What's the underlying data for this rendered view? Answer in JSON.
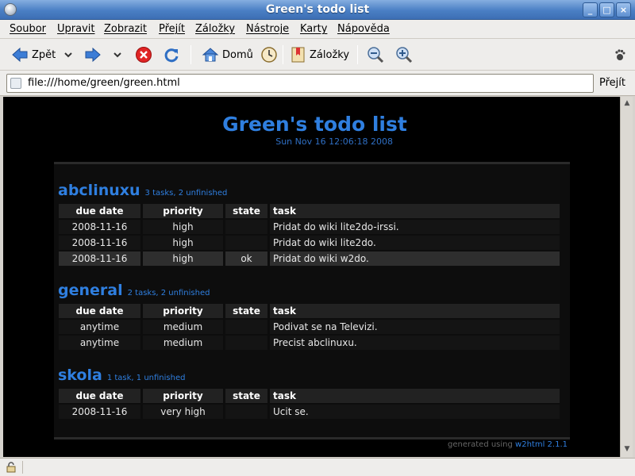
{
  "window": {
    "title": "Green's todo list"
  },
  "menu": [
    "Soubor",
    "Upravit",
    "Zobrazit",
    "Přejít",
    "Záložky",
    "Nástroje",
    "Karty",
    "Nápověda"
  ],
  "toolbar": {
    "back_label": "Zpět",
    "home_label": "Domů",
    "bookmarks_label": "Záložky"
  },
  "urlbar": {
    "url": "file:///home/green/green.html",
    "go_label": "Přejít"
  },
  "page": {
    "title": "Green's todo list",
    "date": "Sun Nov 16 12:06:18 2008",
    "columns": [
      "due date",
      "priority",
      "state",
      "task"
    ],
    "sections": [
      {
        "name": "abclinuxu",
        "meta": "3 tasks, 2 unfinished",
        "rows": [
          {
            "due": "2008-11-16",
            "priority": "high",
            "state": "",
            "task": "Pridat do wiki lite2do-irssi."
          },
          {
            "due": "2008-11-16",
            "priority": "high",
            "state": "",
            "task": "Pridat do wiki lite2do."
          },
          {
            "due": "2008-11-16",
            "priority": "high",
            "state": "ok",
            "task": "Pridat do wiki w2do."
          }
        ]
      },
      {
        "name": "general",
        "meta": "2 tasks, 2 unfinished",
        "rows": [
          {
            "due": "anytime",
            "priority": "medium",
            "state": "",
            "task": "Podivat se na Televizi."
          },
          {
            "due": "anytime",
            "priority": "medium",
            "state": "",
            "task": "Precist abclinuxu."
          }
        ]
      },
      {
        "name": "skola",
        "meta": "1 task, 1 unfinished",
        "rows": [
          {
            "due": "2008-11-16",
            "priority": "very high",
            "state": "",
            "task": "Ucit se."
          }
        ]
      }
    ],
    "footer": {
      "text": "generated using",
      "link": "w2html 2.1.1"
    }
  }
}
